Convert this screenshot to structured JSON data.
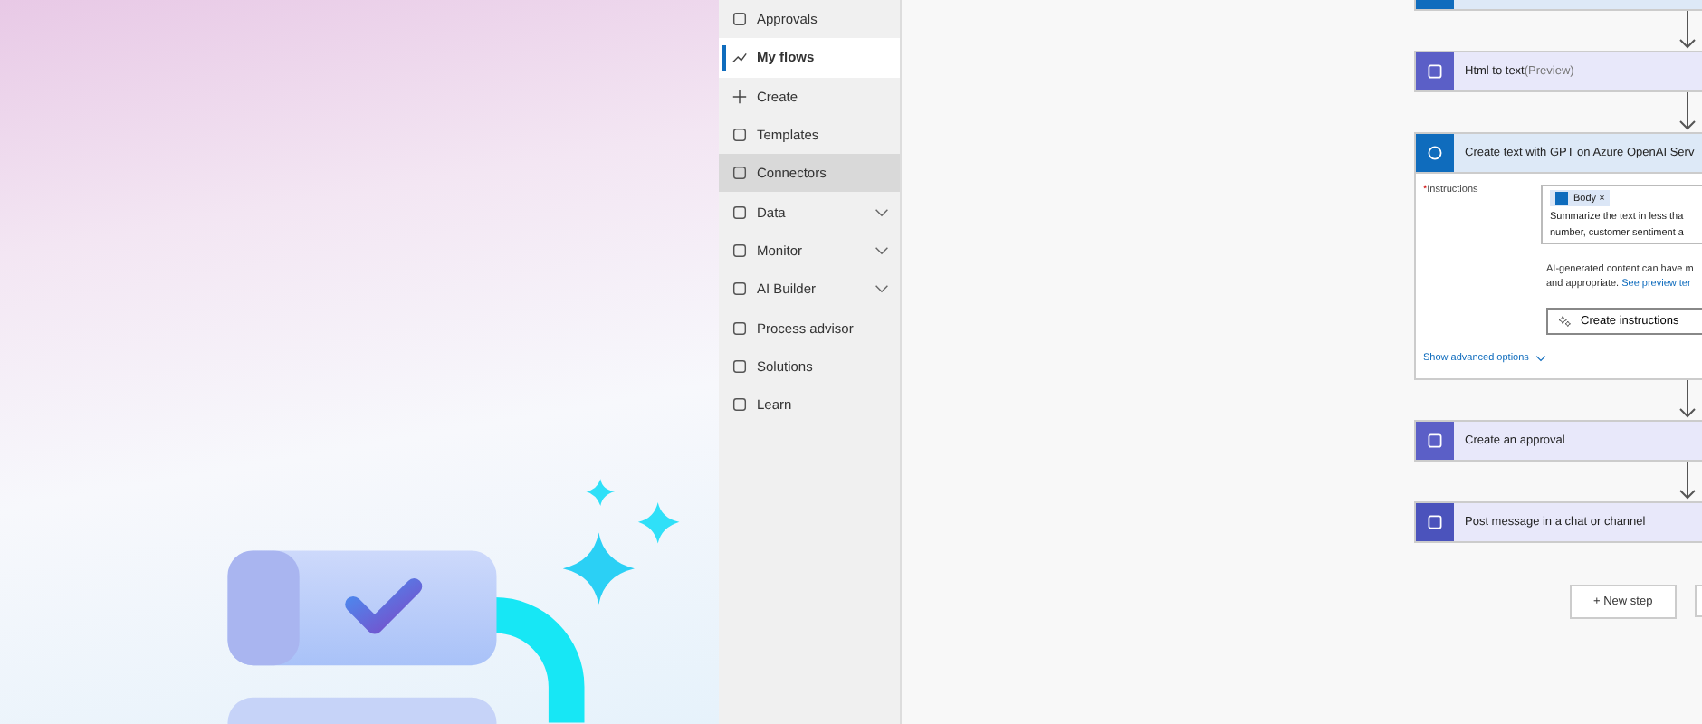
{
  "sidebar": {
    "items": [
      {
        "label": "Approvals",
        "selected": false,
        "hovered": false,
        "expandable": false
      },
      {
        "label": "My flows",
        "selected": true,
        "hovered": false,
        "expandable": false
      },
      {
        "label": "Create",
        "selected": false,
        "hovered": false,
        "expandable": false
      },
      {
        "label": "Templates",
        "selected": false,
        "hovered": false,
        "expandable": false
      },
      {
        "label": "Connectors",
        "selected": false,
        "hovered": true,
        "expandable": false
      },
      {
        "label": "Data",
        "selected": false,
        "hovered": false,
        "expandable": true
      },
      {
        "label": "Monitor",
        "selected": false,
        "hovered": false,
        "expandable": true
      },
      {
        "label": "AI Builder",
        "selected": false,
        "hovered": false,
        "expandable": true
      },
      {
        "label": "Process advisor",
        "selected": false,
        "hovered": false,
        "expandable": false
      },
      {
        "label": "Solutions",
        "selected": false,
        "hovered": false,
        "expandable": false
      },
      {
        "label": "Learn",
        "selected": false,
        "hovered": false,
        "expandable": false
      }
    ]
  },
  "flow": {
    "steps": [
      {
        "kind": "partial"
      },
      {
        "kind": "action",
        "title": "Html to text",
        "suffix": "(Preview)"
      },
      {
        "kind": "expanded",
        "title": "Create text with GPT on Azure OpenAI Serv",
        "required_mark": "*",
        "field_label": "Instructions",
        "token": "Body",
        "token_remove": "×",
        "prompt_lines": [
          "Summarize the text in less tha",
          "number, customer sentiment a"
        ],
        "notice_lines": [
          "AI-generated content can have m",
          "and appropriate."
        ],
        "notice_link": "See preview ter",
        "create_button": "Create instructions",
        "advanced_link": "Show advanced options"
      },
      {
        "kind": "action",
        "title": "Create an approval"
      },
      {
        "kind": "action",
        "title": "Post message in a chat or channel"
      }
    ],
    "new_step": "+ New step"
  }
}
